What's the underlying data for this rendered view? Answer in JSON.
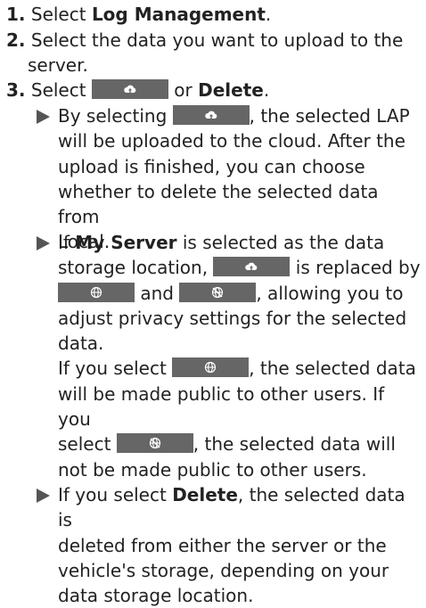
{
  "steps": [
    {
      "num": "1.",
      "pre": "Select ",
      "bold": "Log Management",
      "post": "."
    },
    {
      "num": "2.",
      "text_line1": "Select the data you want to upload to the",
      "text_line2": "server."
    },
    {
      "num": "3.",
      "pre": "Select ",
      "mid": " or ",
      "bold": "Delete",
      "post": "."
    }
  ],
  "bullets": {
    "b1": {
      "l1_pre": "By selecting ",
      "l1_post": ", the selected LAP",
      "l2": "will be uploaded to the cloud. After the",
      "l3": "upload is finished, you can choose",
      "l4": "whether to delete the selected data from",
      "l5": "Local."
    },
    "b2": {
      "l1_pre": "If ",
      "l1_bold": "My Server",
      "l1_post": " is selected as the data",
      "l2_pre": "storage location, ",
      "l2_post": " is replaced by",
      "l3_mid": " and ",
      "l3_post": ", allowing you to",
      "l4": "adjust privacy settings for the selected",
      "l5": "data.",
      "l6_pre": "If you select ",
      "l6_post": ", the selected data",
      "l7": "will be made public to other users. If you",
      "l8_pre": "select ",
      "l8_post": ", the selected data will",
      "l9": "not be made public to other users."
    },
    "b3": {
      "l1_pre": "If you select ",
      "l1_bold": "Delete",
      "l1_post": ", the selected data is",
      "l2": "deleted from either the server or the",
      "l3": "vehicle's storage, depending on your",
      "l4": "data storage location."
    }
  },
  "icons": {
    "upload": "cloud-upload-icon",
    "public": "globe-icon",
    "private": "globe-crossed-icon"
  },
  "colors": {
    "button_bg": "#666666",
    "text": "#222222"
  }
}
